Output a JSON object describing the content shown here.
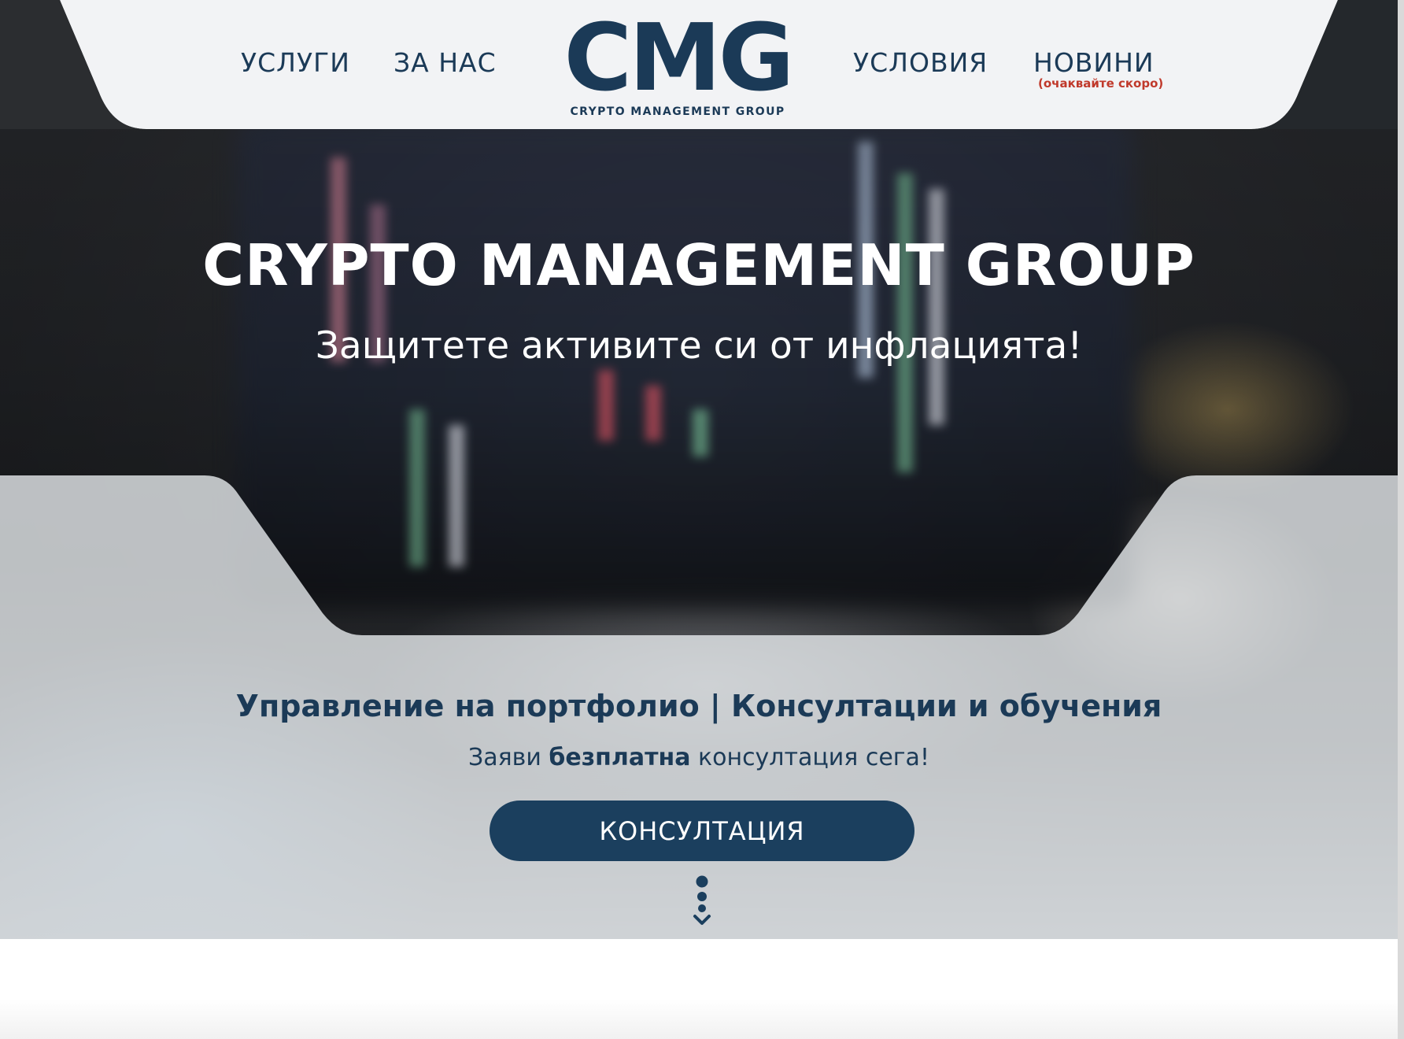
{
  "nav": {
    "services_label": "УСЛУГИ",
    "about_label": "ЗА НАС",
    "terms_label": "УСЛОВИЯ",
    "news_label": "НОВИНИ",
    "news_sublabel": "(очаквайте скоро)"
  },
  "logo": {
    "wordmark": "CMG",
    "tagline": "CRYPTO MANAGEMENT GROUP"
  },
  "hero": {
    "title": "CRYPTO MANAGEMENT GROUP",
    "subtitle": "Защитете активите си от инфлацията!",
    "services_line": "Управление на портфолио | Консултации и обучения",
    "cta_prefix": "Заяви ",
    "cta_bold": "безплатна",
    "cta_suffix": " консултация сега!",
    "cta_button_label": "КОНСУЛТАЦИЯ"
  },
  "colors": {
    "brand_navy": "#1b3a57",
    "button_navy": "#1b3f5e",
    "accent_red": "#c0392b",
    "header_bg": "#f2f3f5"
  },
  "icons": {
    "scroll_down": "scroll-down-dots-chevron-icon"
  }
}
